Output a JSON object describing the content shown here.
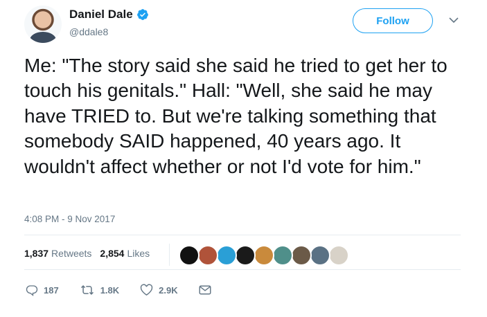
{
  "author": {
    "name": "Daniel Dale",
    "handle": "@ddale8"
  },
  "follow_label": "Follow",
  "tweet": {
    "text": "Me: \"The story said she said he tried to get her to touch his genitals.\" Hall: \"Well, she said he may have TRIED to. But we're talking something that somebody SAID happened, 40 years ago. It wouldn't affect whether or not I'd vote for him.\"",
    "timestamp": "4:08 PM - 9 Nov 2017"
  },
  "stats": {
    "retweets_count": "1,837",
    "retweets_label": "Retweets",
    "likes_count": "2,854",
    "likes_label": "Likes"
  },
  "likers": [
    {
      "color": "#111111"
    },
    {
      "color": "#b0533a"
    },
    {
      "color": "#2a9fd6"
    },
    {
      "color": "#1a1a1a"
    },
    {
      "color": "#c98a3c"
    },
    {
      "color": "#4f8f8a"
    },
    {
      "color": "#6b5a48"
    },
    {
      "color": "#5a7184"
    },
    {
      "color": "#d8d2c8"
    }
  ],
  "actions": {
    "replies": "187",
    "retweets": "1.8K",
    "likes": "2.9K"
  },
  "colors": {
    "accent": "#1da1f2",
    "muted": "#657786",
    "text": "#14171a",
    "divider": "#e6ecf0"
  }
}
